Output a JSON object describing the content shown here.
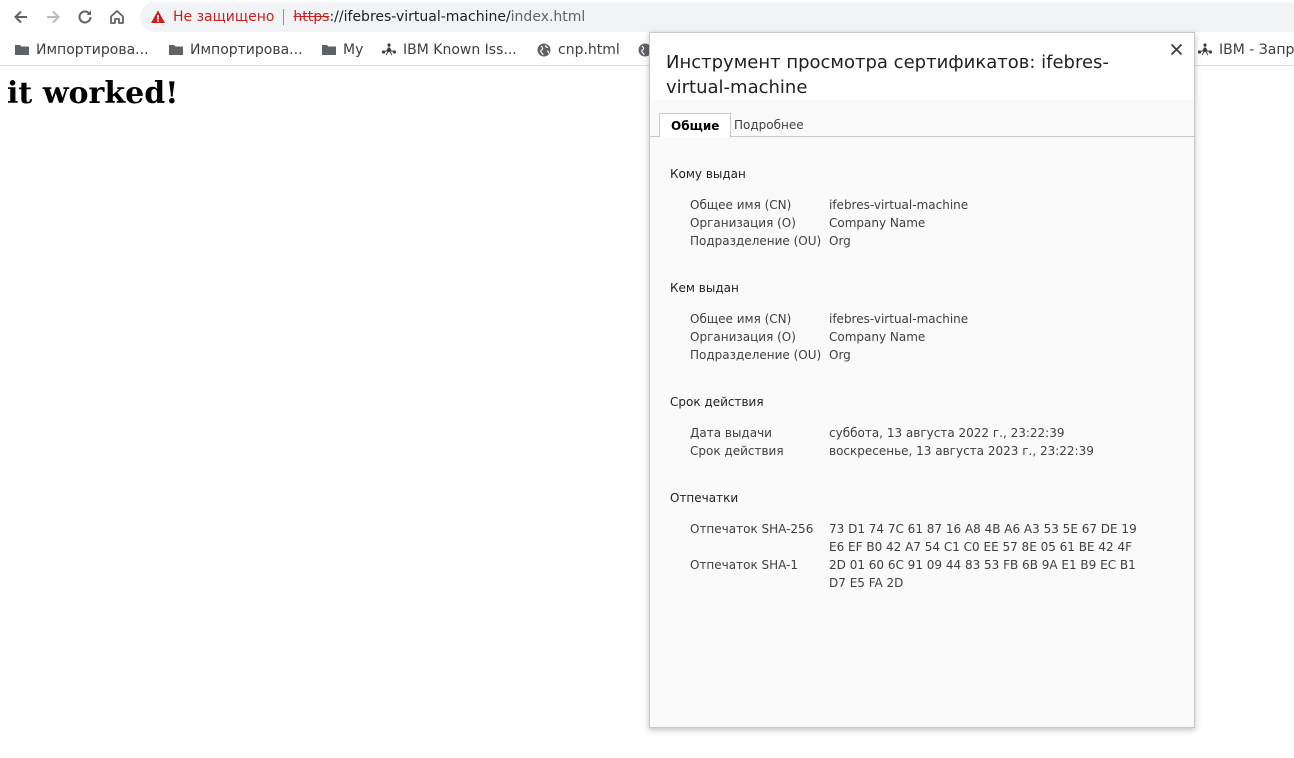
{
  "omnibox": {
    "security_label": "Не защищено",
    "url_scheme": "https",
    "url_host": "://ifebres-virtual-machine/",
    "url_path": "index.html"
  },
  "bookmarks": [
    {
      "label": "Импортирова...",
      "icon": "folder-icon"
    },
    {
      "label": "Импортирова...",
      "icon": "folder-icon"
    },
    {
      "label": "My",
      "icon": "folder-icon"
    },
    {
      "label": "IBM Known Iss...",
      "icon": "ibm-icon"
    },
    {
      "label": "cnp.html",
      "icon": "globe-icon"
    },
    {
      "label": "",
      "icon": "globe-icon"
    },
    {
      "label": "IBM - Запр",
      "icon": "ibm-icon"
    }
  ],
  "page": {
    "heading": "it worked!"
  },
  "cert_dialog": {
    "title": "Инструмент просмотра сертификатов: ifebres-virtual-machine",
    "tabs": [
      "Общие",
      "Подробнее"
    ],
    "issued_to": {
      "title": "Кому выдан",
      "rows": [
        {
          "label": "Общее имя (CN)",
          "value": "ifebres-virtual-machine"
        },
        {
          "label": "Организация (O)",
          "value": "Company Name"
        },
        {
          "label": "Подразделение (OU)",
          "value": "Org"
        }
      ]
    },
    "issued_by": {
      "title": "Кем выдан",
      "rows": [
        {
          "label": "Общее имя (CN)",
          "value": "ifebres-virtual-machine"
        },
        {
          "label": "Организация (O)",
          "value": "Company Name"
        },
        {
          "label": "Подразделение (OU)",
          "value": "Org"
        }
      ]
    },
    "validity": {
      "title": "Срок действия",
      "rows": [
        {
          "label": "Дата выдачи",
          "value": "суббота, 13 августа 2022 г., 23:22:39"
        },
        {
          "label": "Срок действия",
          "value": "воскресенье, 13 августа 2023 г., 23:22:39"
        }
      ]
    },
    "fingerprints": {
      "title": "Отпечатки",
      "sha256_label": "Отпечаток SHA-256",
      "sha256_lines": [
        "73 D1 74 7C 61 87 16 A8 4B A6 A3 53 5E 67 DE 19",
        "E6 EF B0 42 A7 54 C1 C0 EE 57 8E 05 61 BE 42 4F"
      ],
      "sha1_label": "Отпечаток SHA-1",
      "sha1_lines": [
        "2D 01 60 6C 91 09 44 83 53 FB 6B 9A E1 B9 EC B1",
        "D7 E5 FA 2D"
      ]
    }
  }
}
